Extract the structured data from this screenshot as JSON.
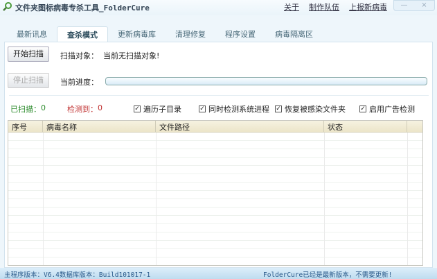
{
  "window": {
    "title": "文件夹图标病毒专杀工具_FolderCure",
    "links": [
      "关于",
      "制作队伍",
      "上报新病毒"
    ],
    "minimize": "—",
    "close": "×"
  },
  "tabs": [
    {
      "label": "最新讯息"
    },
    {
      "label": "查杀模式",
      "active": true
    },
    {
      "label": "更新病毒库"
    },
    {
      "label": "清理修复"
    },
    {
      "label": "程序设置"
    },
    {
      "label": "病毒隔离区"
    }
  ],
  "scan": {
    "start_label": "开始扫描",
    "target_label": "扫描对象：",
    "target_value": "当前无扫描对象!",
    "stop_label": "停止扫描",
    "progress_label": "当前进度：",
    "progress": 0
  },
  "stats": {
    "scanned_label": "已扫描：",
    "scanned": "0",
    "detected_label": "检测到：",
    "detected": "0"
  },
  "options": [
    {
      "label": "遍历子目录",
      "checked": true
    },
    {
      "label": "同时检测系统进程",
      "checked": true
    },
    {
      "label": "恢复被感染文件夹",
      "checked": true
    },
    {
      "label": "启用广告检测",
      "checked": true
    }
  ],
  "table": {
    "columns": [
      "序号",
      "病毒名称",
      "文件路径",
      "状态"
    ],
    "rows": []
  },
  "statusbar": {
    "left": "主程序版本：V6.4数据库版本：Build101017-1",
    "right": "FolderCure已经是最新版本，不需要更新!"
  },
  "colors": {
    "scanned": "#2a8a2a",
    "detected": "#c03030"
  }
}
